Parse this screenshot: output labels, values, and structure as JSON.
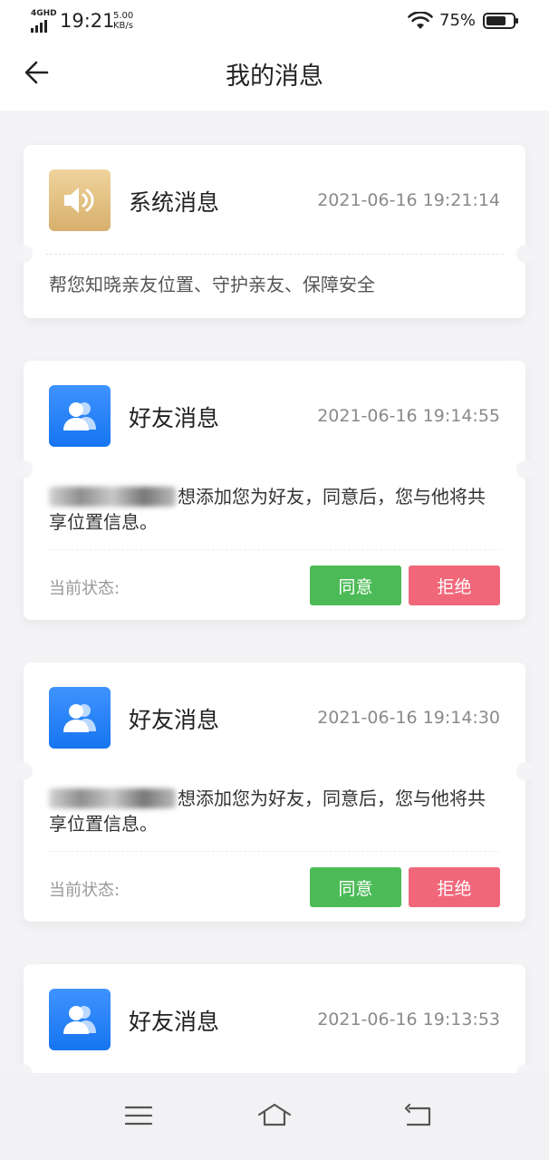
{
  "status_bar": {
    "network": "4GHD",
    "time": "19:21",
    "speed_value": "5.00",
    "speed_unit": "KB/s",
    "battery": "75%",
    "battery_level": 0.75
  },
  "header": {
    "title": "我的消息",
    "back_icon": "arrow-left-icon"
  },
  "messages": [
    {
      "type": "system",
      "icon": "speaker-icon",
      "title": "系统消息",
      "time": "2021-06-16 19:21:14",
      "body": "帮您知晓亲友位置、守护亲友、保障安全"
    },
    {
      "type": "friend",
      "icon": "users-icon",
      "title": "好友消息",
      "time": "2021-06-16 19:14:55",
      "body": "想添加您为好友，同意后，您与他将共享位置信息。",
      "status_label": "当前状态:",
      "agree_label": "同意",
      "reject_label": "拒绝"
    },
    {
      "type": "friend",
      "icon": "users-icon",
      "title": "好友消息",
      "time": "2021-06-16 19:14:30",
      "body": "想添加您为好友，同意后，您与他将共享位置信息。",
      "status_label": "当前状态:",
      "agree_label": "同意",
      "reject_label": "拒绝"
    },
    {
      "type": "friend",
      "icon": "users-icon",
      "title": "好友消息",
      "time": "2021-06-16 19:13:53"
    }
  ],
  "bottom_nav": {
    "menu_icon": "menu-icon",
    "home_icon": "home-icon",
    "back_icon": "back-return-icon"
  },
  "colors": {
    "agree": "#4cbb57",
    "reject": "#f1677a",
    "system_avatar": "#e2c080",
    "friend_avatar": "#2a85f8",
    "background": "#f4f4f6"
  }
}
